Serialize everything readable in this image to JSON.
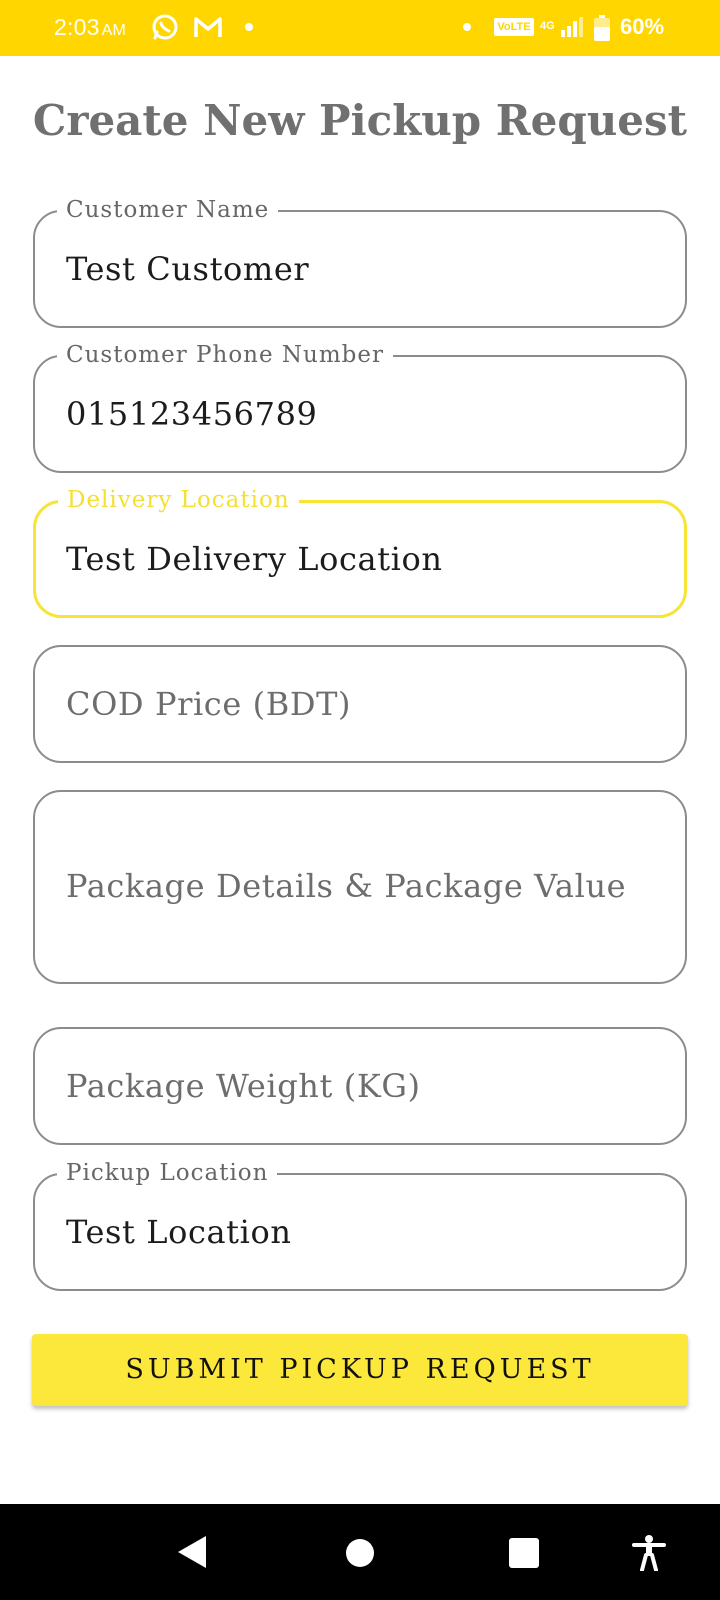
{
  "status_bar": {
    "time": "2:03",
    "ampm": "AM",
    "network_badge": "VoLTE",
    "network_type": "4G",
    "battery": "60%",
    "icons": [
      "whatsapp-icon",
      "gmail-icon",
      "notification-dot-icon",
      "signal-icon",
      "battery-icon"
    ]
  },
  "page": {
    "title": "Create New Pickup Request"
  },
  "form": {
    "customer_name": {
      "label": "Customer Name",
      "value": "Test Customer"
    },
    "customer_phone": {
      "label": "Customer Phone Number",
      "value": "015123456789"
    },
    "delivery_location": {
      "label": "Delivery Location",
      "value": "Test Delivery Location",
      "focused": true
    },
    "cod_price": {
      "placeholder": "COD Price (BDT)"
    },
    "package_details": {
      "placeholder": "Package Details & Package Value"
    },
    "package_weight": {
      "placeholder": "Package Weight (KG)"
    },
    "pickup_location": {
      "label": "Pickup Location",
      "value": "Test Location"
    },
    "submit_label": "SUBMIT PICKUP REQUEST"
  },
  "colors": {
    "status_bar": "#FFD600",
    "accent": "#F7E437",
    "button": "#FCE83A",
    "border": "#8c8c8c"
  },
  "nav_bar": {
    "icons": [
      "back-icon",
      "home-icon",
      "recents-icon",
      "accessibility-icon"
    ]
  }
}
